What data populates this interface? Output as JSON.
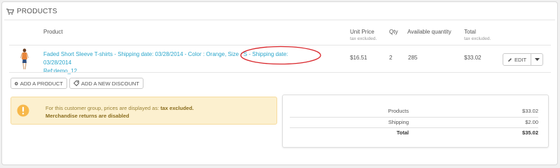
{
  "panel": {
    "title": "PRODUCTS"
  },
  "table": {
    "headers": {
      "product": "Product",
      "unit_price": "Unit Price",
      "unit_price_sub": "tax excluded.",
      "qty": "Qty",
      "available": "Available quantity",
      "total": "Total",
      "total_sub": "tax excluded."
    },
    "row": {
      "product_name": "Faded Short Sleeve T-shirts - Shipping date: 03/28/2014 - Color : Orange, Size : S - Shipping date: 03/28/2014",
      "reference": "Ref:demo_12",
      "unit_price": "$16.51",
      "qty": "2",
      "available": "285",
      "total": "$33.02",
      "edit_label": "EDIT"
    }
  },
  "actions": {
    "add_product": "ADD A PRODUCT",
    "add_discount": "ADD A NEW DISCOUNT"
  },
  "notice": {
    "line1_prefix": "For this customer group, prices are displayed as: ",
    "line1_emphasis": "tax excluded.",
    "line2": "Merchandise returns are disabled"
  },
  "summary": {
    "products_label": "Products",
    "products_value": "$33.02",
    "shipping_label": "Shipping",
    "shipping_value": "$2.00",
    "total_label": "Total",
    "total_value": "$35.02"
  },
  "colors": {
    "link": "#2ba6cb",
    "warning_bg": "#fcf0cf",
    "warning_icon": "#f7b84a",
    "annotation": "#d9262b"
  }
}
